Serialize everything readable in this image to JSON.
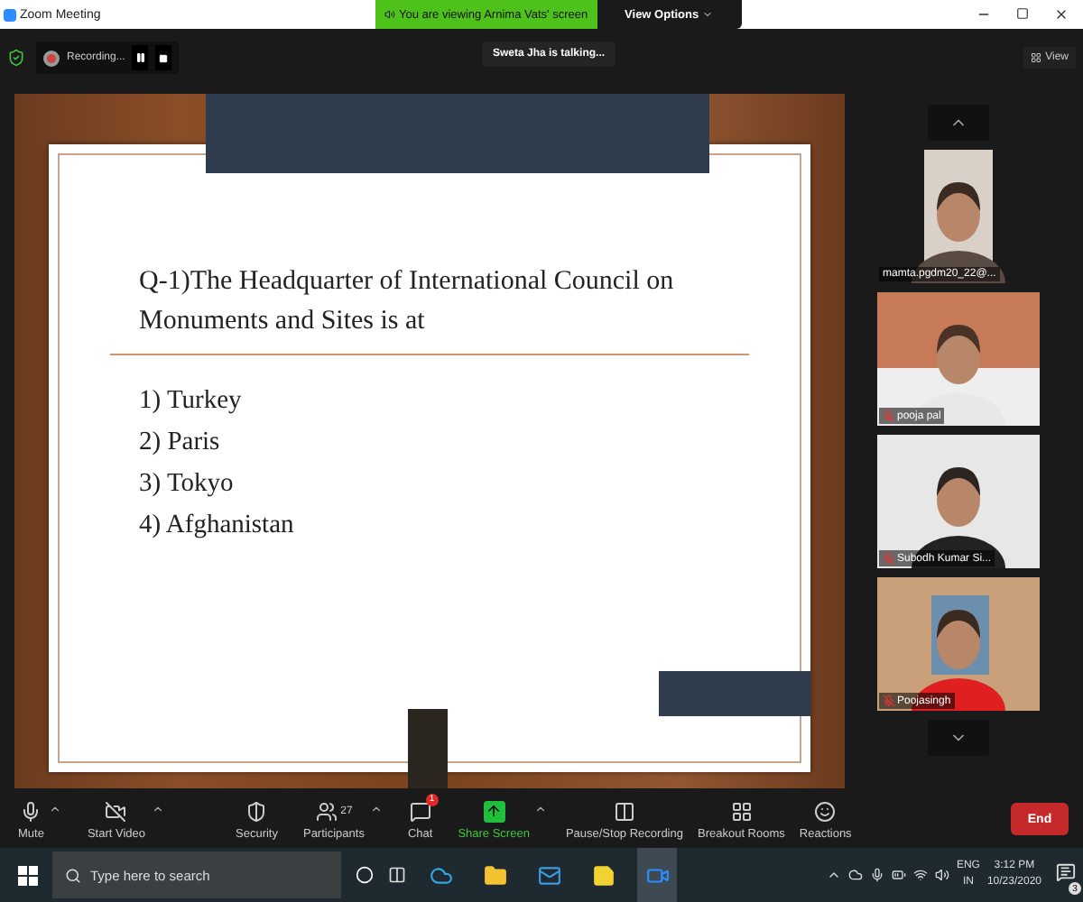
{
  "window": {
    "title": "Zoom Meeting"
  },
  "banner": {
    "text": "You are viewing Arnima Vats' screen",
    "view_options": "View Options"
  },
  "top_bar": {
    "recording": "Recording...",
    "talking": "Sweta Jha is talking...",
    "view": "View"
  },
  "slide": {
    "question": "Q-1)The Headquarter of International Council on Monuments and Sites is at",
    "options": [
      "1) Turkey",
      "2) Paris",
      "3) Tokyo",
      "4) Afghanistan"
    ]
  },
  "participants": [
    {
      "name": "mamta.pgdm20_22@...",
      "muted": false
    },
    {
      "name": "pooja pal",
      "muted": true
    },
    {
      "name": "Subodh Kumar Si...",
      "muted": true
    },
    {
      "name": "Poojasingh",
      "muted": true
    }
  ],
  "toolbar": {
    "items": [
      {
        "kind": "mute",
        "label": "Mute",
        "caret": true
      },
      {
        "kind": "video",
        "label": "Start Video",
        "caret": true
      },
      {
        "kind": "security",
        "label": "Security",
        "caret": false
      },
      {
        "kind": "participants",
        "label": "Participants",
        "count": "27",
        "caret": true
      },
      {
        "kind": "chat",
        "label": "Chat",
        "badge": "1",
        "caret": false
      },
      {
        "kind": "share",
        "label": "Share Screen",
        "caret": true
      },
      {
        "kind": "record",
        "label": "Pause/Stop Recording",
        "caret": false
      },
      {
        "kind": "breakout",
        "label": "Breakout Rooms",
        "caret": false
      },
      {
        "kind": "reactions",
        "label": "Reactions",
        "caret": false
      }
    ],
    "end": "End"
  },
  "taskbar": {
    "search_placeholder": "Type here to search",
    "language": "ENG",
    "region": "IN",
    "time": "3:12 PM",
    "date": "10/23/2020",
    "notifications": "3"
  }
}
